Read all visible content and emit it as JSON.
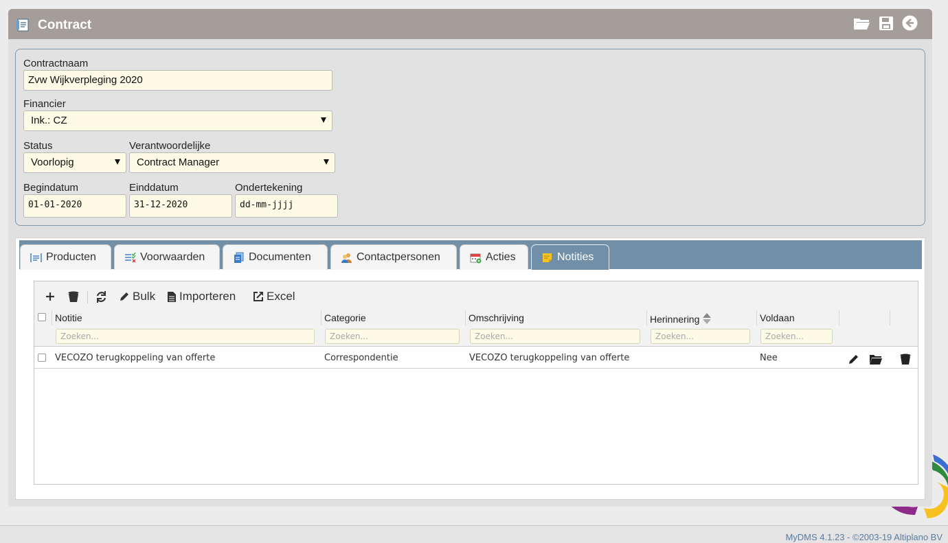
{
  "window": {
    "title": "Contract",
    "title_icon": "contract-doc-icon"
  },
  "titlebar_icons": [
    "folder-open-icon",
    "save-icon",
    "back-arrow-icon"
  ],
  "form": {
    "contractnaam": {
      "label": "Contractnaam",
      "value": "Zvw Wijkverpleging 2020"
    },
    "financier": {
      "label": "Financier",
      "value": "Ink.: CZ"
    },
    "status": {
      "label": "Status",
      "value": "Voorlopig"
    },
    "verantwoordelijke": {
      "label": "Verantwoordelijke",
      "value": "Contract Manager"
    },
    "begindatum": {
      "label": "Begindatum",
      "value": "01-01-2020"
    },
    "einddatum": {
      "label": "Einddatum",
      "value": "31-12-2020"
    },
    "ondertekening": {
      "label": "Ondertekening",
      "value": "dd-mm-jjjj"
    }
  },
  "tabs": [
    {
      "label": "Producten",
      "icon": "list-icon"
    },
    {
      "label": "Voorwaarden",
      "icon": "checklist-icon"
    },
    {
      "label": "Documenten",
      "icon": "documents-icon"
    },
    {
      "label": "Contactpersonen",
      "icon": "contacts-icon"
    },
    {
      "label": "Acties",
      "icon": "calendar-icon"
    },
    {
      "label": "Notities",
      "icon": "note-icon",
      "active": true
    }
  ],
  "toolbar": {
    "add": "add-icon",
    "delete": "trash-icon",
    "refresh": "refresh-icon",
    "bulk_label": "Bulk",
    "import_label": "Importeren",
    "excel_label": "Excel"
  },
  "grid": {
    "columns": [
      "Notitie",
      "Categorie",
      "Omschrijving",
      "Herinnering",
      "Voldaan"
    ],
    "search_placeholder": "Zoeken...",
    "rows": [
      {
        "notitie": "VECOZO terugkoppeling van offerte",
        "categorie": "Correspondentie",
        "omschrijving": "VECOZO terugkoppeling van offerte",
        "herinnering": "",
        "voldaan": "Nee"
      }
    ]
  },
  "footer": {
    "text": "MyDMS 4.1.23 - ©2003-19 Altiplano BV"
  },
  "colors": {
    "titlebar": "#a59d9a",
    "tabs_bar": "#718fa6",
    "field_bg": "#fdfae6",
    "footer_text": "#5b7ba0"
  }
}
